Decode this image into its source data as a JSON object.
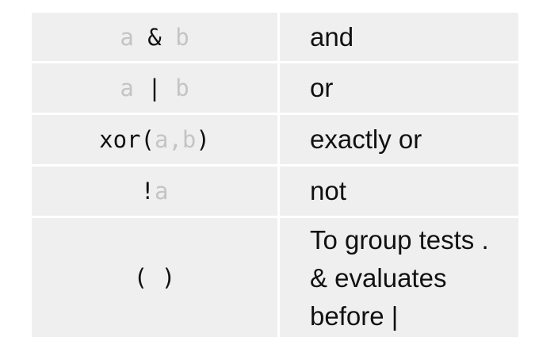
{
  "rows": [
    {
      "code": {
        "a": "a",
        "op": " & ",
        "b": "b"
      },
      "description": "and"
    },
    {
      "code": {
        "a": "a",
        "op": " | ",
        "b": "b"
      },
      "description": "or"
    },
    {
      "code": {
        "prefix": "xor(",
        "a": "a",
        "sep": ",",
        "b": "b",
        "suffix": ")"
      },
      "description": "exactly or"
    },
    {
      "code": {
        "prefix": "!",
        "a": "a"
      },
      "description": "not"
    },
    {
      "code": {
        "text": "( )"
      },
      "description_lines": [
        "To group tests .",
        "& evaluates",
        "before |"
      ]
    }
  ]
}
